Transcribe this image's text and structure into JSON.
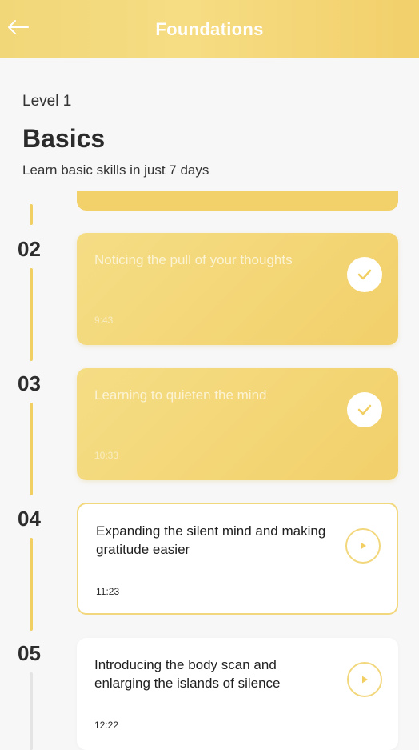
{
  "header": {
    "title": "Foundations",
    "back_icon": "arrow-left-icon"
  },
  "level": {
    "label": "Level 1",
    "title": "Basics",
    "subtitle": "Learn basic skills in just 7 days"
  },
  "sessions": [
    {
      "number": "02",
      "title": "Noticing the pull of your thoughts",
      "duration": "9:43",
      "status": "completed",
      "icon": "check-icon"
    },
    {
      "number": "03",
      "title": "Learning to quieten the mind",
      "duration": "10:33",
      "status": "completed",
      "icon": "check-icon"
    },
    {
      "number": "04",
      "title": "Expanding the silent mind and making gratitude easier",
      "duration": "11:23",
      "status": "current",
      "icon": "play-icon"
    },
    {
      "number": "05",
      "title": "Introducing the body scan and enlarging the islands of silence",
      "duration": "12:22",
      "status": "locked",
      "icon": "play-icon"
    }
  ],
  "colors": {
    "accent": "#f2d06a",
    "header": "#f4d87c",
    "background": "#f7f7f8",
    "text": "#2a2a2a"
  }
}
